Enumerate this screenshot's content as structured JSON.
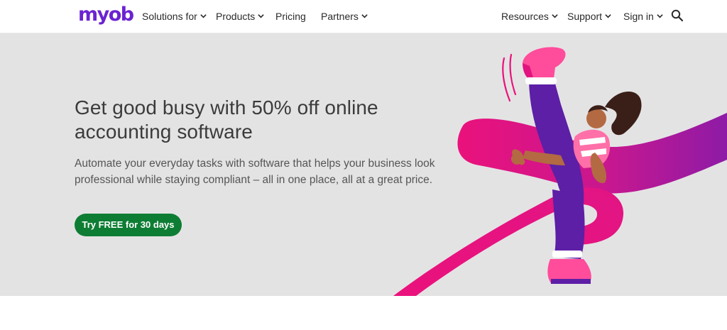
{
  "brand": {
    "logo_text": "myob",
    "logo_color": "#6b23d1",
    "accent_green": "#0e7d34",
    "accent_pink": "#e9137f"
  },
  "nav": {
    "left": [
      {
        "label": "Solutions for",
        "dropdown": true
      },
      {
        "label": "Products",
        "dropdown": true
      },
      {
        "label": "Pricing",
        "dropdown": false
      },
      {
        "label": "Partners",
        "dropdown": true
      }
    ],
    "right": [
      {
        "label": "Resources",
        "dropdown": true
      },
      {
        "label": "Support",
        "dropdown": true
      },
      {
        "label": "Sign in",
        "dropdown": true
      }
    ],
    "search_icon": "search-icon"
  },
  "hero": {
    "title": "Get good busy with 50% off online accounting software",
    "description": "Automate your everyday tasks with software that helps your business look professional while staying compliant – all in one place, all at a great price.",
    "cta_label": "Try FREE for 30 days",
    "illustration": "kicking-person-illustration"
  }
}
